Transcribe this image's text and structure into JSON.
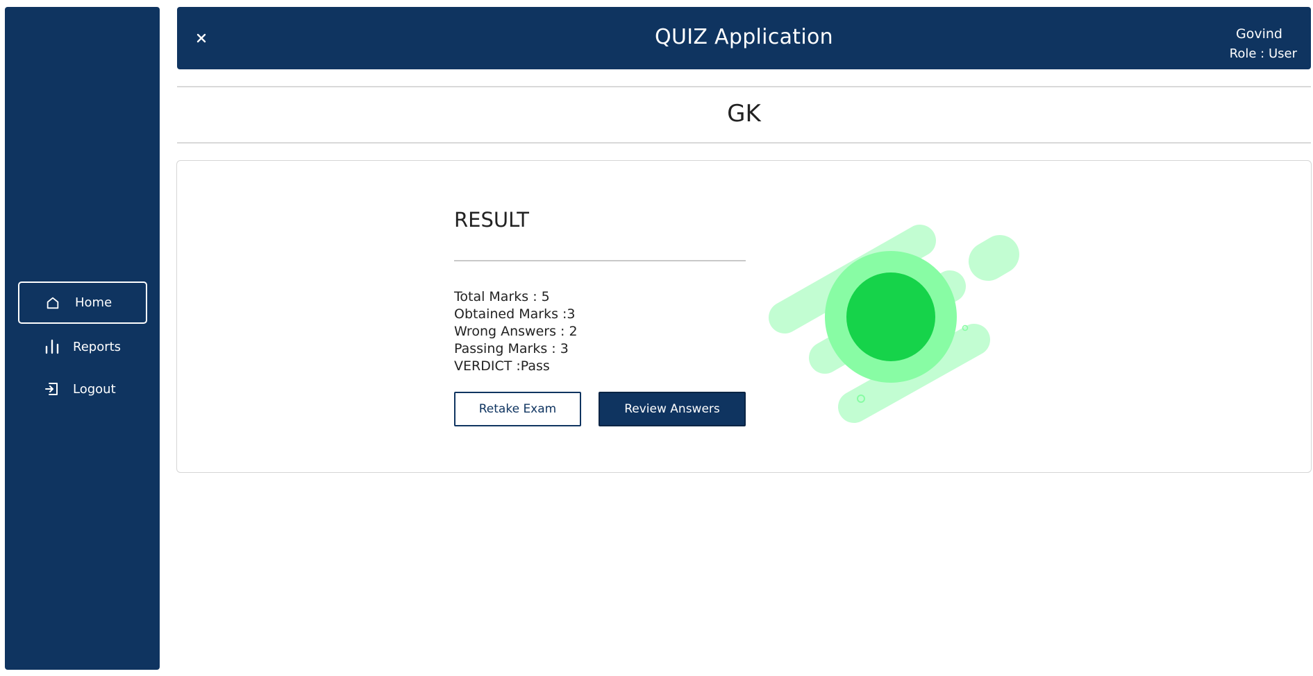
{
  "sidebar": {
    "items": [
      {
        "label": "Home",
        "icon": "home-icon",
        "active": true
      },
      {
        "label": "Reports",
        "icon": "bar-chart-icon",
        "active": false
      },
      {
        "label": "Logout",
        "icon": "logout-icon",
        "active": false
      }
    ]
  },
  "header": {
    "title": "QUIZ Application",
    "user_name": "Govind",
    "user_role": "Role : User"
  },
  "quiz": {
    "name": "GK"
  },
  "result": {
    "title": "RESULT",
    "total_marks": "Total Marks : 5",
    "obtained_marks": "Obtained Marks :3",
    "wrong_answers": "Wrong Answers : 2",
    "passing_marks": "Passing Marks : 3",
    "verdict": "VERDICT :Pass"
  },
  "buttons": {
    "retake": "Retake Exam",
    "review": "Review Answers"
  },
  "colors": {
    "primary": "#0f3460",
    "pass_green": "#16d34a",
    "pass_light": "#88fca4",
    "pass_pale": "#c2fdd2"
  }
}
